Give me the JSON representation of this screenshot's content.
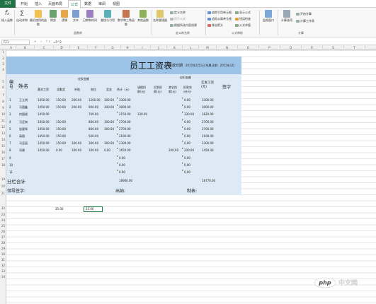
{
  "ribbon_tabs": {
    "file": "文件",
    "tabs": [
      "开始",
      "插入",
      "页面布局",
      "公式",
      "数据",
      "审阅",
      "视图"
    ],
    "active": "公式"
  },
  "ribbon": {
    "buttons": [
      "插入函数",
      "自动求和",
      "最近使用的函数",
      "财务",
      "逻辑",
      "文本",
      "日期和时间",
      "查找与引用",
      "数学和三角函数",
      "其他函数",
      "名称管理器",
      "监视窗口",
      "计算选项"
    ],
    "name_cmds": [
      "定义名称",
      "用于公式",
      "根据所选内容创建"
    ],
    "audit_cmds": [
      "追踪引用单元格",
      "追踪从属单元格",
      "移去箭头",
      "显示公式",
      "错误检查",
      "公式求值"
    ],
    "calc_cmds": [
      "开始计算",
      "计算工作表"
    ],
    "groups": [
      "函数库",
      "定义的名称",
      "公式审核",
      "计算"
    ],
    "accent": "#217346"
  },
  "formula_bar": {
    "name_box": "F21",
    "icons": "✕ ✓ fx",
    "formula": "=5^2"
  },
  "columns": [
    "A",
    "B",
    "C",
    "D",
    "E",
    "F",
    "G",
    "H",
    "I",
    "J",
    "K",
    "L",
    "M",
    "N",
    "O",
    "P",
    "Q",
    "R",
    "S",
    "T"
  ],
  "rows": [
    "1",
    "2",
    "3",
    "4",
    "5",
    "6",
    "7",
    "8",
    "9",
    "10",
    "11",
    "12",
    "13",
    "14",
    "15",
    "16",
    "17",
    "18",
    "19",
    "20",
    "21",
    "22",
    "23",
    "24",
    "25",
    "26",
    "27",
    "28",
    "29",
    "30",
    "31",
    "32",
    "33",
    "34"
  ],
  "sheet": {
    "title": "员工工资表",
    "issue_date": "发放日期",
    "date_range": "2015年2月1日 所属日期：2015年1月",
    "header_no": "编号",
    "header_name": "姓名",
    "header_payable": "应发金额",
    "header_deduct": "应扣金额",
    "header_sign": "签字",
    "subheaders": [
      "基本工资",
      "全勤奖",
      "补助",
      "岗位",
      "奖金",
      "合计（元）",
      "请假扣款(元)",
      "迟到扣款(元)",
      "其它扣款(元)",
      "扣款合计(元)",
      "实发工资(元)"
    ],
    "rows": [
      {
        "no": "1",
        "name": "王立明",
        "v": [
          "1450.00",
          "150.00",
          "200.00",
          "1200.00",
          "300.00",
          "3300.00",
          "",
          "",
          "",
          "0.00",
          "3300.00"
        ]
      },
      {
        "no": "2",
        "name": "马国鑫",
        "v": [
          "1450.00",
          "150.00",
          "200.00",
          "900.00",
          "300.00",
          "3000.00",
          "",
          "",
          "",
          "0.00",
          "3000.00"
        ]
      },
      {
        "no": "3",
        "name": "何国斌",
        "v": [
          "1450.00",
          "",
          "",
          "700.00",
          "",
          "2150.00",
          "330.00",
          "",
          "",
          "330.00",
          "1820.00"
        ]
      },
      {
        "no": "4",
        "name": "马亚南",
        "v": [
          "1450.00",
          "150.00",
          "",
          "800.00",
          "300.00",
          "2700.00",
          "",
          "",
          "",
          "0.00",
          "2700.00"
        ]
      },
      {
        "no": "5",
        "name": "张要琴",
        "v": [
          "1450.00",
          "150.00",
          "",
          "800.00",
          "300.00",
          "2700.00",
          "",
          "",
          "",
          "0.00",
          "2700.00"
        ]
      },
      {
        "no": "6",
        "name": "高翔",
        "v": [
          "1450.00",
          "150.00",
          "",
          "500.00",
          "",
          "2100.00",
          "",
          "",
          "",
          "0.00",
          "2100.00"
        ]
      },
      {
        "no": "7",
        "name": "马亚丽",
        "v": [
          "1450.00",
          "150.00",
          "100.00",
          "300.00",
          "300.00",
          "2300.00",
          "",
          "",
          "",
          "0.00",
          "2300.00"
        ]
      },
      {
        "no": "8",
        "name": "邓建",
        "v": [
          "1450.00",
          "0.00",
          "100.00",
          "100.00",
          "0.00",
          "1650.00",
          "",
          "",
          "200.00",
          "200.00",
          "1450.00"
        ]
      },
      {
        "no": "9",
        "name": "",
        "v": [
          "",
          "",
          "",
          "",
          "",
          "0.00",
          "",
          "",
          "",
          "0.00",
          ""
        ]
      },
      {
        "no": "10",
        "name": "",
        "v": [
          "",
          "",
          "",
          "",
          "",
          "0.00",
          "",
          "",
          "",
          "0.00",
          ""
        ]
      },
      {
        "no": "11",
        "name": "",
        "v": [
          "",
          "",
          "",
          "",
          "",
          "0.00",
          "",
          "",
          "",
          "0.00",
          ""
        ]
      }
    ],
    "subtotal_label": "分栏合计",
    "subtotal_h": "18900.00",
    "subtotal_m": "18770.00",
    "leader_sign": "领导签字:",
    "cashier": "出纳:",
    "preparer": "制表:",
    "cell_c21": "25.00",
    "cell_f21": "25.00"
  },
  "watermark": "php 中文网"
}
